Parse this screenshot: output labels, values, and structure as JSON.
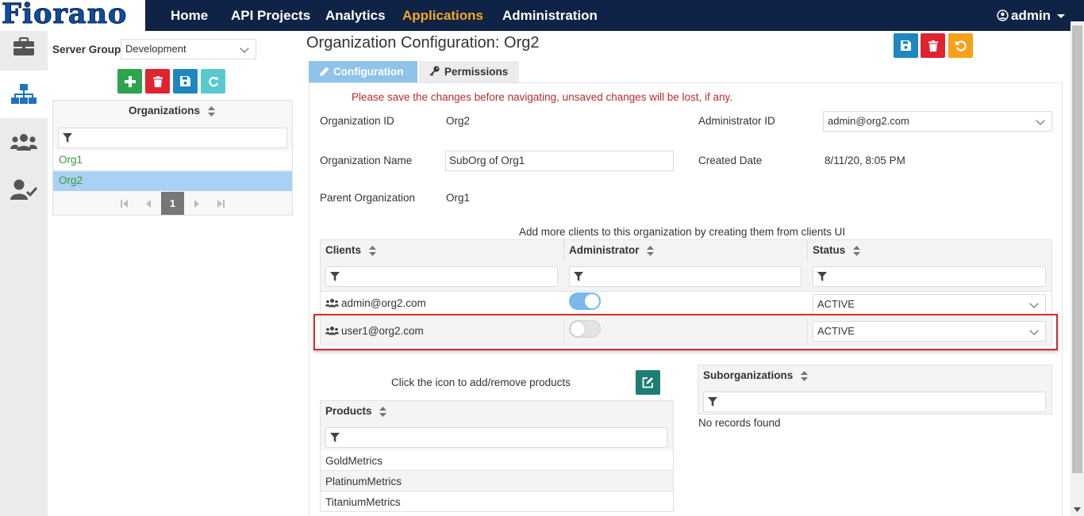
{
  "brand": {
    "logo_text": "Fiorano"
  },
  "nav": {
    "items": [
      "Home",
      "API Projects",
      "Analytics",
      "Applications",
      "Administration"
    ],
    "active": "Applications",
    "user": "admin"
  },
  "rail": {
    "icons": [
      "briefcase-icon",
      "sitemap-icon",
      "users-icon",
      "user-check-icon"
    ],
    "active": "sitemap-icon"
  },
  "left": {
    "server_group_label": "Server Group",
    "server_group_value": "Development",
    "organizations_header": "Organizations",
    "organizations": [
      "Org1",
      "Org2"
    ],
    "selected": "Org2",
    "page": "1"
  },
  "main": {
    "title": "Organization Configuration: Org2",
    "tabs": [
      "Configuration",
      "Permissions"
    ],
    "active_tab": "Configuration",
    "warning": "Please save the changes before navigating, unsaved changes will be lost, if any.",
    "fields": {
      "org_id_label": "Organization ID",
      "org_id_value": "Org2",
      "admin_id_label": "Administrator ID",
      "admin_id_value": "admin@org2.com",
      "org_name_label": "Organization Name",
      "org_name_value": "SubOrg of Org1",
      "created_label": "Created Date",
      "created_value": "8/11/20, 8:05 PM",
      "parent_label": "Parent Organization",
      "parent_value": "Org1"
    },
    "clients_note": "Add more clients to this organization by creating them from clients UI",
    "clients_table": {
      "headers": [
        "Clients",
        "Administrator",
        "Status"
      ],
      "rows": [
        {
          "client": "admin@org2.com",
          "administrator": true,
          "status": "ACTIVE"
        },
        {
          "client": "user1@org2.com",
          "administrator": false,
          "status": "ACTIVE"
        }
      ]
    },
    "products_note": "Click the icon to add/remove products",
    "products_header": "Products",
    "products": [
      "GoldMetrics",
      "PlatinumMetrics",
      "TitaniumMetrics"
    ],
    "suborgs_header": "Suborganizations",
    "suborgs_empty": "No records found"
  },
  "colors": {
    "navbar": "#0e2346",
    "active_nav": "#f5a623",
    "add_green": "#2ea44f",
    "delete_red": "#e0242f",
    "save_blue": "#1f86c0",
    "refresh_teal": "#5bc8d0",
    "undo_orange": "#f7a11a",
    "tab_active": "#8fc3e9",
    "toggle_on": "#7ab8ec",
    "warning_red": "#b72d2d",
    "org_link_green": "#3a9a3a",
    "selected_row": "#a9d1f4",
    "edit_teal": "#1d7d74"
  }
}
